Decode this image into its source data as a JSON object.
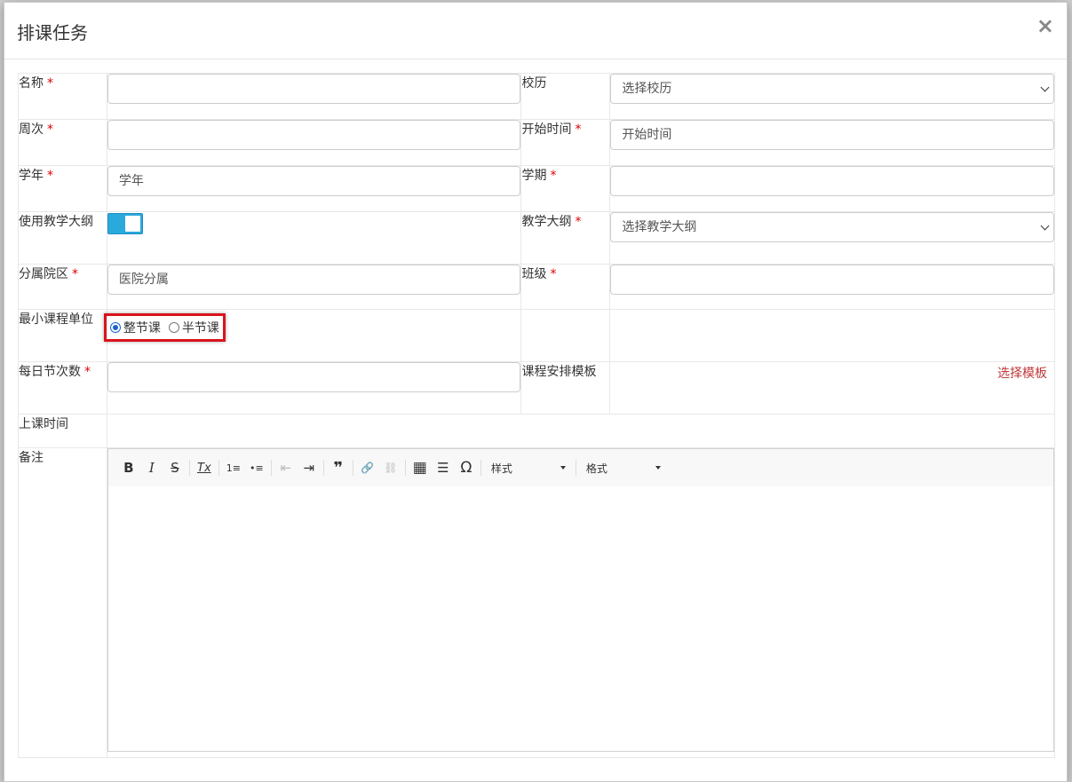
{
  "modal": {
    "title": "排课任务",
    "close": "×"
  },
  "fields": {
    "name": {
      "label": "名称",
      "req": "*"
    },
    "calendar": {
      "label": "校历",
      "value": "选择校历"
    },
    "week": {
      "label": "周次",
      "req": "*"
    },
    "start_time": {
      "label": "开始时间",
      "req": "*",
      "placeholder": "开始时间"
    },
    "year": {
      "label": "学年",
      "req": "*",
      "placeholder": "学年"
    },
    "term": {
      "label": "学期",
      "req": "*"
    },
    "use_syllabus": {
      "label": "使用教学大纲",
      "enabled": true
    },
    "syllabus": {
      "label": "教学大纲",
      "req": "*",
      "value": "选择教学大纲"
    },
    "campus": {
      "label": "分属院区",
      "req": "*",
      "placeholder": "医院分属"
    },
    "class": {
      "label": "班级",
      "req": "*"
    },
    "min_unit": {
      "label": "最小课程单位",
      "options": [
        "整节课",
        "半节课"
      ],
      "selected": "整节课"
    },
    "daily_sessions": {
      "label": "每日节次数",
      "req": "*"
    },
    "template": {
      "label": "课程安排模板",
      "link": "选择模板"
    },
    "class_time": {
      "label": "上课时间"
    },
    "remarks": {
      "label": "备注"
    }
  },
  "editor": {
    "buttons": {
      "bold": "B",
      "italic": "I",
      "strike": "S",
      "clear": "Tx",
      "ol": "1≡",
      "ul": "•≡",
      "outdent": "⇤",
      "indent": "⇥",
      "quote": "❞",
      "link": "🔗",
      "unlink": "⛓",
      "table": "▦",
      "hr": "☰",
      "special": "Ω"
    },
    "style_label": "样式",
    "format_label": "格式"
  }
}
